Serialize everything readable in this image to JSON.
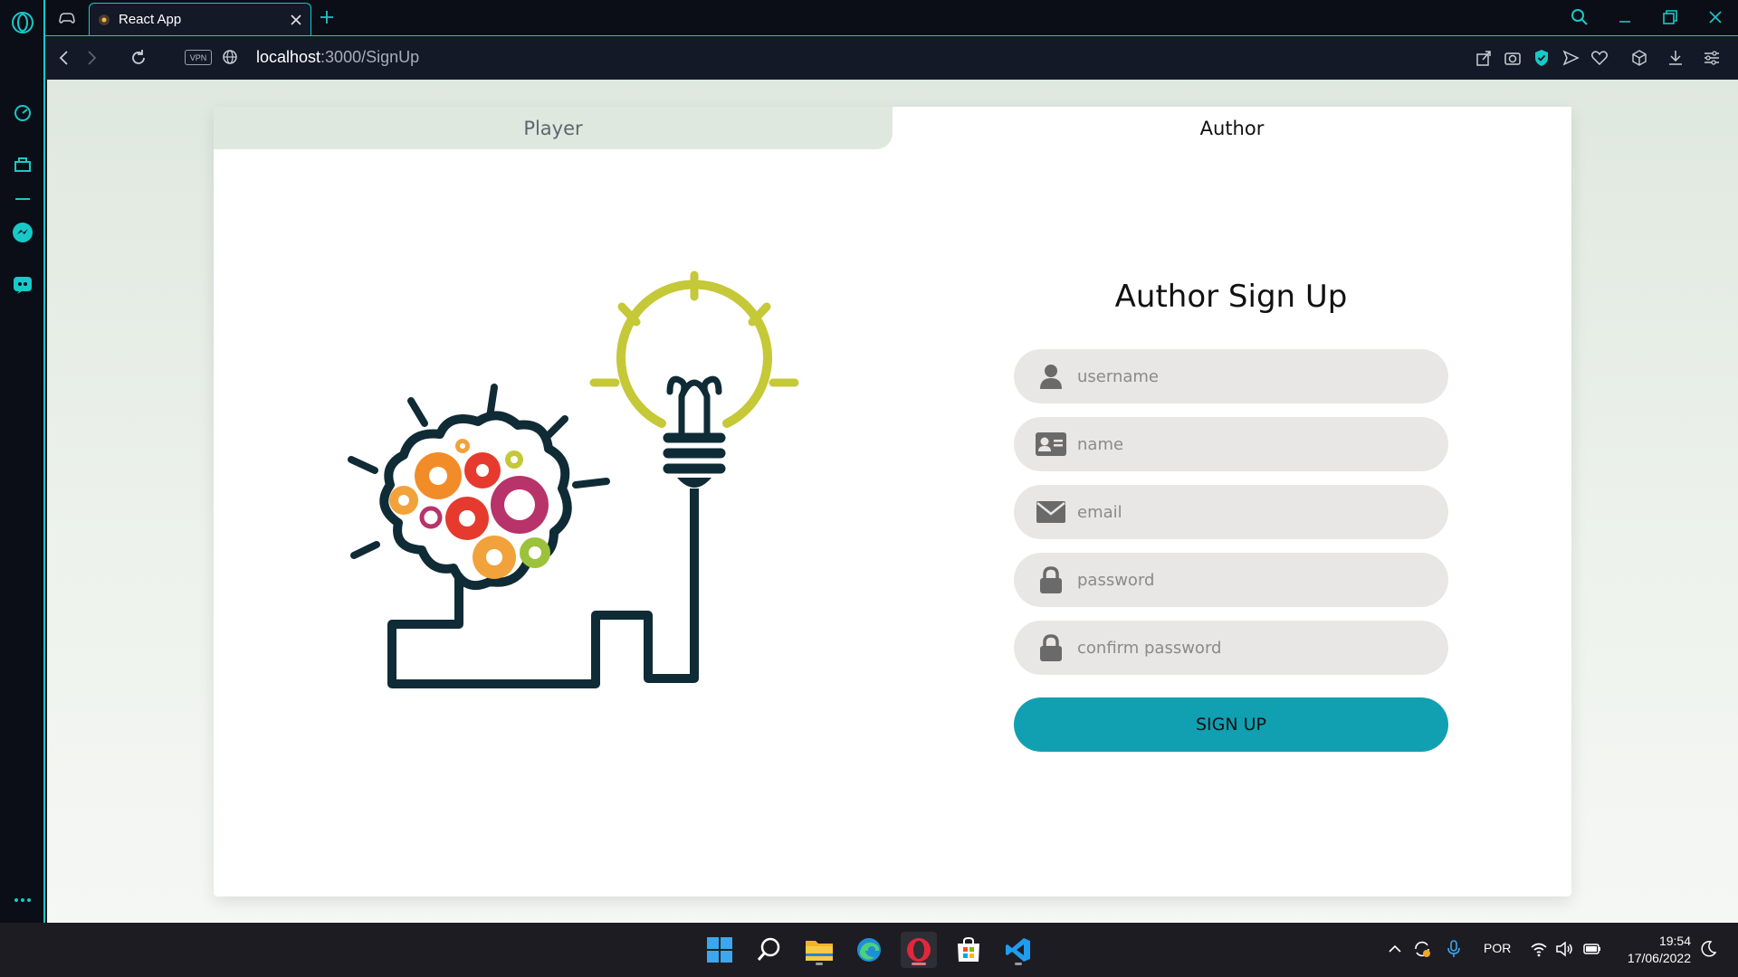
{
  "browser": {
    "tab_title": "React App",
    "url_host": "localhost",
    "url_path": ":3000/SignUp",
    "vpn_label": "VPN",
    "accent_color": "#17c9c9"
  },
  "page": {
    "tabs": [
      {
        "label": "Player",
        "active": false
      },
      {
        "label": "Author",
        "active": true
      }
    ],
    "form": {
      "title": "Author Sign Up",
      "fields": [
        {
          "placeholder": "username",
          "icon": "user-icon",
          "type": "text"
        },
        {
          "placeholder": "name",
          "icon": "id-card-icon",
          "type": "text"
        },
        {
          "placeholder": "email",
          "icon": "envelope-icon",
          "type": "email"
        },
        {
          "placeholder": "password",
          "icon": "lock-icon",
          "type": "password"
        },
        {
          "placeholder": "confirm password",
          "icon": "lock-icon",
          "type": "password"
        }
      ],
      "submit_label": "SIGN UP",
      "submit_color": "#11a0b1"
    },
    "illustration": "brain-gears-lightbulb-icon"
  },
  "taskbar": {
    "apps": [
      "windows-start-icon",
      "search-icon",
      "file-explorer-icon",
      "edge-icon",
      "opera-icon",
      "microsoft-store-icon",
      "vscode-icon"
    ],
    "language": "POR",
    "time": "19:54",
    "date": "17/06/2022"
  }
}
